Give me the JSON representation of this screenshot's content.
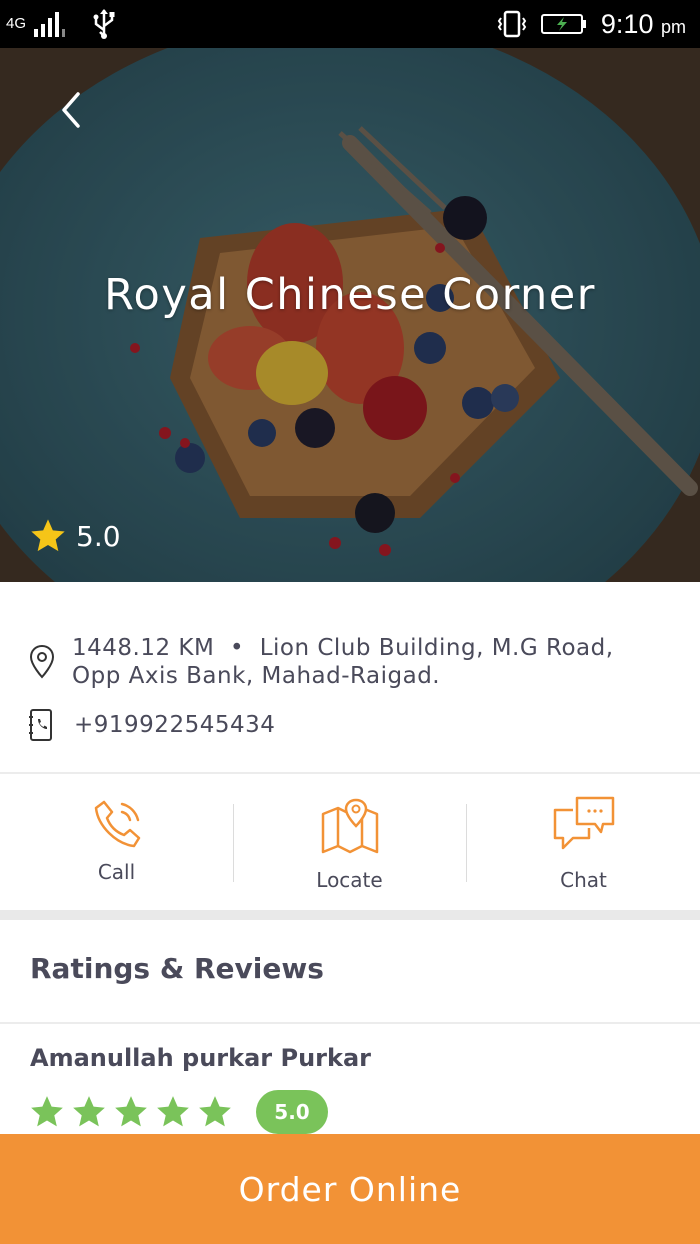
{
  "status_bar": {
    "network": "4G",
    "time": "9:10",
    "ampm": "pm"
  },
  "restaurant": {
    "name": "Royal Chinese Corner",
    "rating": "5.0",
    "distance": "1448.12 KM",
    "address_line1": "Lion Club Building, M.G Road,",
    "address_line2": "Opp Axis Bank, Mahad-Raigad.",
    "separator": "•",
    "phone": "+919922545434"
  },
  "actions": [
    {
      "label": "Call",
      "icon": "phone-icon"
    },
    {
      "label": "Locate",
      "icon": "map-pin-icon"
    },
    {
      "label": "Chat",
      "icon": "chat-bubbles-icon"
    }
  ],
  "reviews": {
    "heading": "Ratings & Reviews",
    "items": [
      {
        "name": "Amanullah purkar Purkar",
        "stars": 5,
        "score": "5.0"
      }
    ]
  },
  "order_button": {
    "label": "Order Online"
  },
  "colors": {
    "accent": "#f29236",
    "star_gold": "#f5c518",
    "star_green": "#7ac35a",
    "text": "#4a4a5a"
  }
}
